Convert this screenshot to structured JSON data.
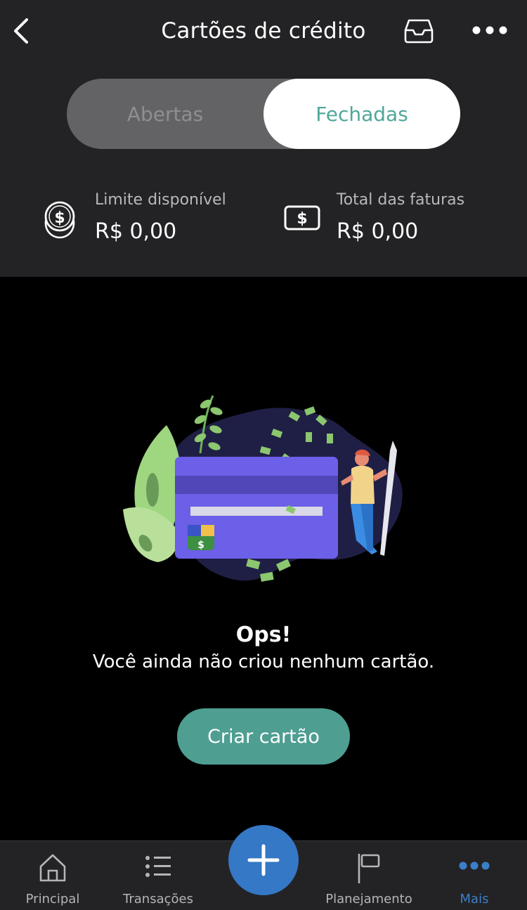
{
  "header": {
    "title": "Cartões de crédito",
    "back_icon": "chevron-left-icon",
    "inbox_icon": "inbox-tray-icon",
    "more_icon": "more-dots-icon"
  },
  "tabs": {
    "open_label": "Abertas",
    "closed_label": "Fechadas",
    "selected": "Fechadas"
  },
  "summary": {
    "limit_label": "Limite disponível",
    "limit_value": "R$ 0,00",
    "limit_icon": "coins-dollar-icon",
    "invoices_label": "Total das faturas",
    "invoices_value": "R$ 0,00",
    "invoices_icon": "banknote-dollar-icon"
  },
  "empty_state": {
    "title": "Ops!",
    "message": "Você ainda não criou nenhum cartão.",
    "button_label": "Criar cartão",
    "illustration": "credit-card-illustration"
  },
  "tabbar": {
    "items": [
      {
        "label": "Principal",
        "icon": "home-icon"
      },
      {
        "label": "Transações",
        "icon": "list-icon"
      },
      {
        "label": "Planejamento",
        "icon": "flag-icon"
      },
      {
        "label": "Mais",
        "icon": "more-dots-icon"
      }
    ],
    "active": "Mais",
    "fab_icon": "plus-icon"
  },
  "colors": {
    "background": "#000000",
    "panel": "#232325",
    "accent_teal": "#4e9e92",
    "accent_blue": "#3478c6",
    "card_purple": "#6c5fe8"
  }
}
